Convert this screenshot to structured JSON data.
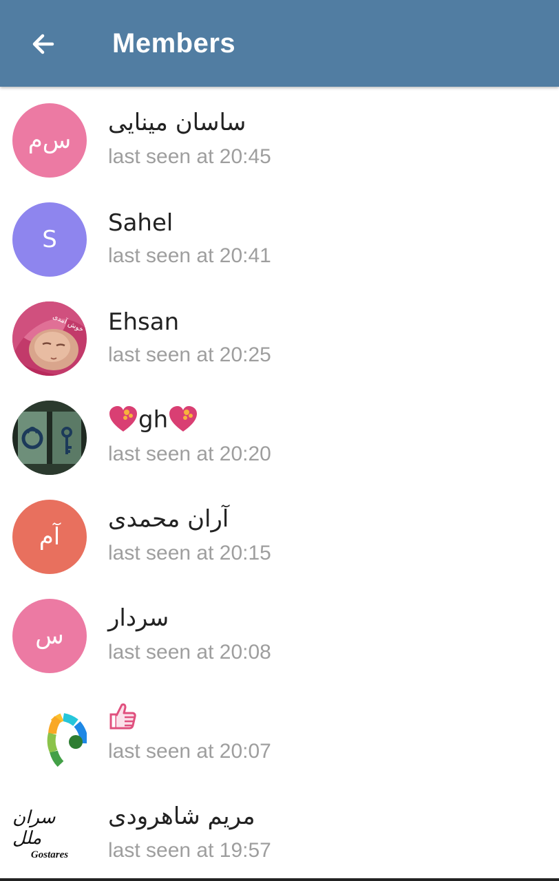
{
  "appbar": {
    "title": "Members",
    "back_icon": "arrow-left-icon",
    "background": "#517da2"
  },
  "members": [
    {
      "name": "ساسان مینایی",
      "status": "last seen at 20:45",
      "initials": "س‌م",
      "avatar_color": "#ec7aa3"
    },
    {
      "name": "Sahel",
      "status": "last seen at 20:41",
      "initials": "S",
      "avatar_color": "#8e85ee"
    },
    {
      "name": "Ehsan",
      "status": "last seen at 20:25",
      "avatar_type": "photo"
    },
    {
      "name_emoji_left": "heart-emoji",
      "name_text": "gh",
      "name_emoji_right": "heart-emoji",
      "status": "last seen at 20:20",
      "avatar_type": "photo"
    },
    {
      "name": "آران محمدی",
      "status": "last seen at 20:15",
      "initials": "آم",
      "avatar_color": "#e8705e"
    },
    {
      "name": "سردار",
      "status": "last seen at 20:08",
      "initials": "س",
      "avatar_color": "#ec7aa3"
    },
    {
      "name_emoji": "thumbs-up-emoji",
      "status": "last seen at 20:07",
      "avatar_type": "logo"
    },
    {
      "name": "مریم شاهرودی",
      "status": "last seen at 19:57",
      "avatar_type": "logo",
      "logo_text": "سران ملل",
      "logo_subtext": "Gostares"
    }
  ]
}
